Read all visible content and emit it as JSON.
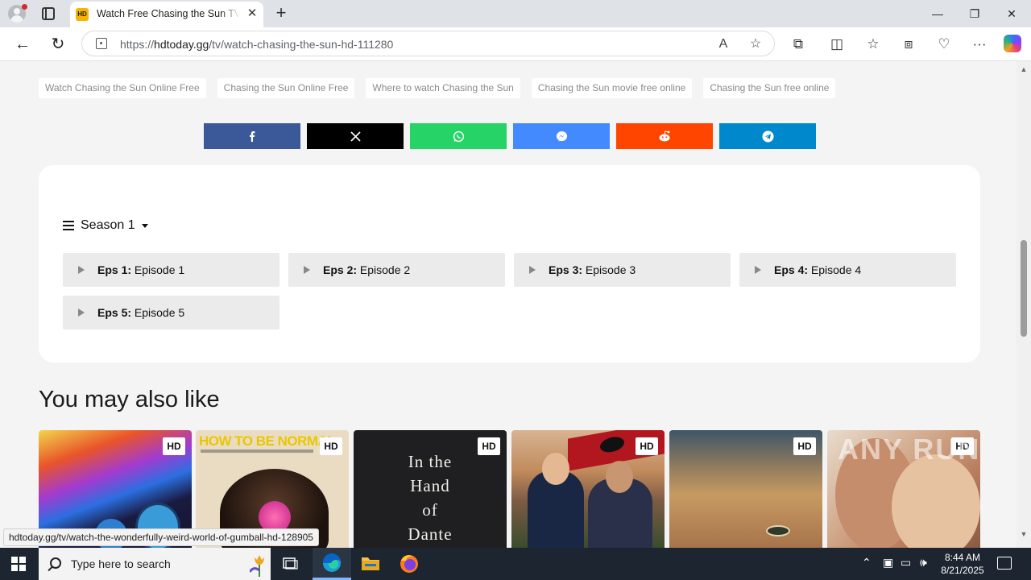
{
  "browser": {
    "tab_title": "Watch Free Chasing the Sun TV Shows Online",
    "tab_favicon": "HD",
    "url_prefix": "https://",
    "url_domain": "hdtoday.gg",
    "url_path": "/tv/watch-chasing-the-sun-hd-111280",
    "close_glyph": "✕",
    "new_tab_glyph": "+"
  },
  "tags": [
    "Watch Chasing the Sun Online Free",
    "Chasing the Sun Online Free",
    "Where to watch Chasing the Sun",
    "Chasing the Sun movie free online",
    "Chasing the Sun free online"
  ],
  "share": [
    {
      "name": "facebook",
      "color": "#3b5998"
    },
    {
      "name": "x",
      "color": "#000000"
    },
    {
      "name": "whatsapp",
      "color": "#25d366"
    },
    {
      "name": "messenger",
      "color": "#448aff"
    },
    {
      "name": "reddit",
      "color": "#ff4500"
    },
    {
      "name": "telegram",
      "color": "#0088cc"
    }
  ],
  "episodes_section": {
    "season_label": "Season 1",
    "episodes": [
      {
        "num": "Eps 1:",
        "title": "Episode 1"
      },
      {
        "num": "Eps 2:",
        "title": "Episode 2"
      },
      {
        "num": "Eps 3:",
        "title": "Episode 3"
      },
      {
        "num": "Eps 4:",
        "title": "Episode 4"
      },
      {
        "num": "Eps 5:",
        "title": "Episode 5"
      }
    ]
  },
  "related": {
    "heading": "You may also like",
    "badge": "HD",
    "poster_texts": {
      "how_to_be_normal": "HOW TO BE NORMAL",
      "hand_of_dante": [
        "In the",
        "Hand",
        "of",
        "Dante"
      ]
    }
  },
  "watermark": "ANY RUN",
  "status_bar_url": "hdtoday.gg/tv/watch-the-wonderfully-weird-world-of-gumball-hd-128905",
  "taskbar": {
    "search_placeholder": "Type here to search",
    "time": "8:44 AM",
    "date": "8/21/2025"
  }
}
